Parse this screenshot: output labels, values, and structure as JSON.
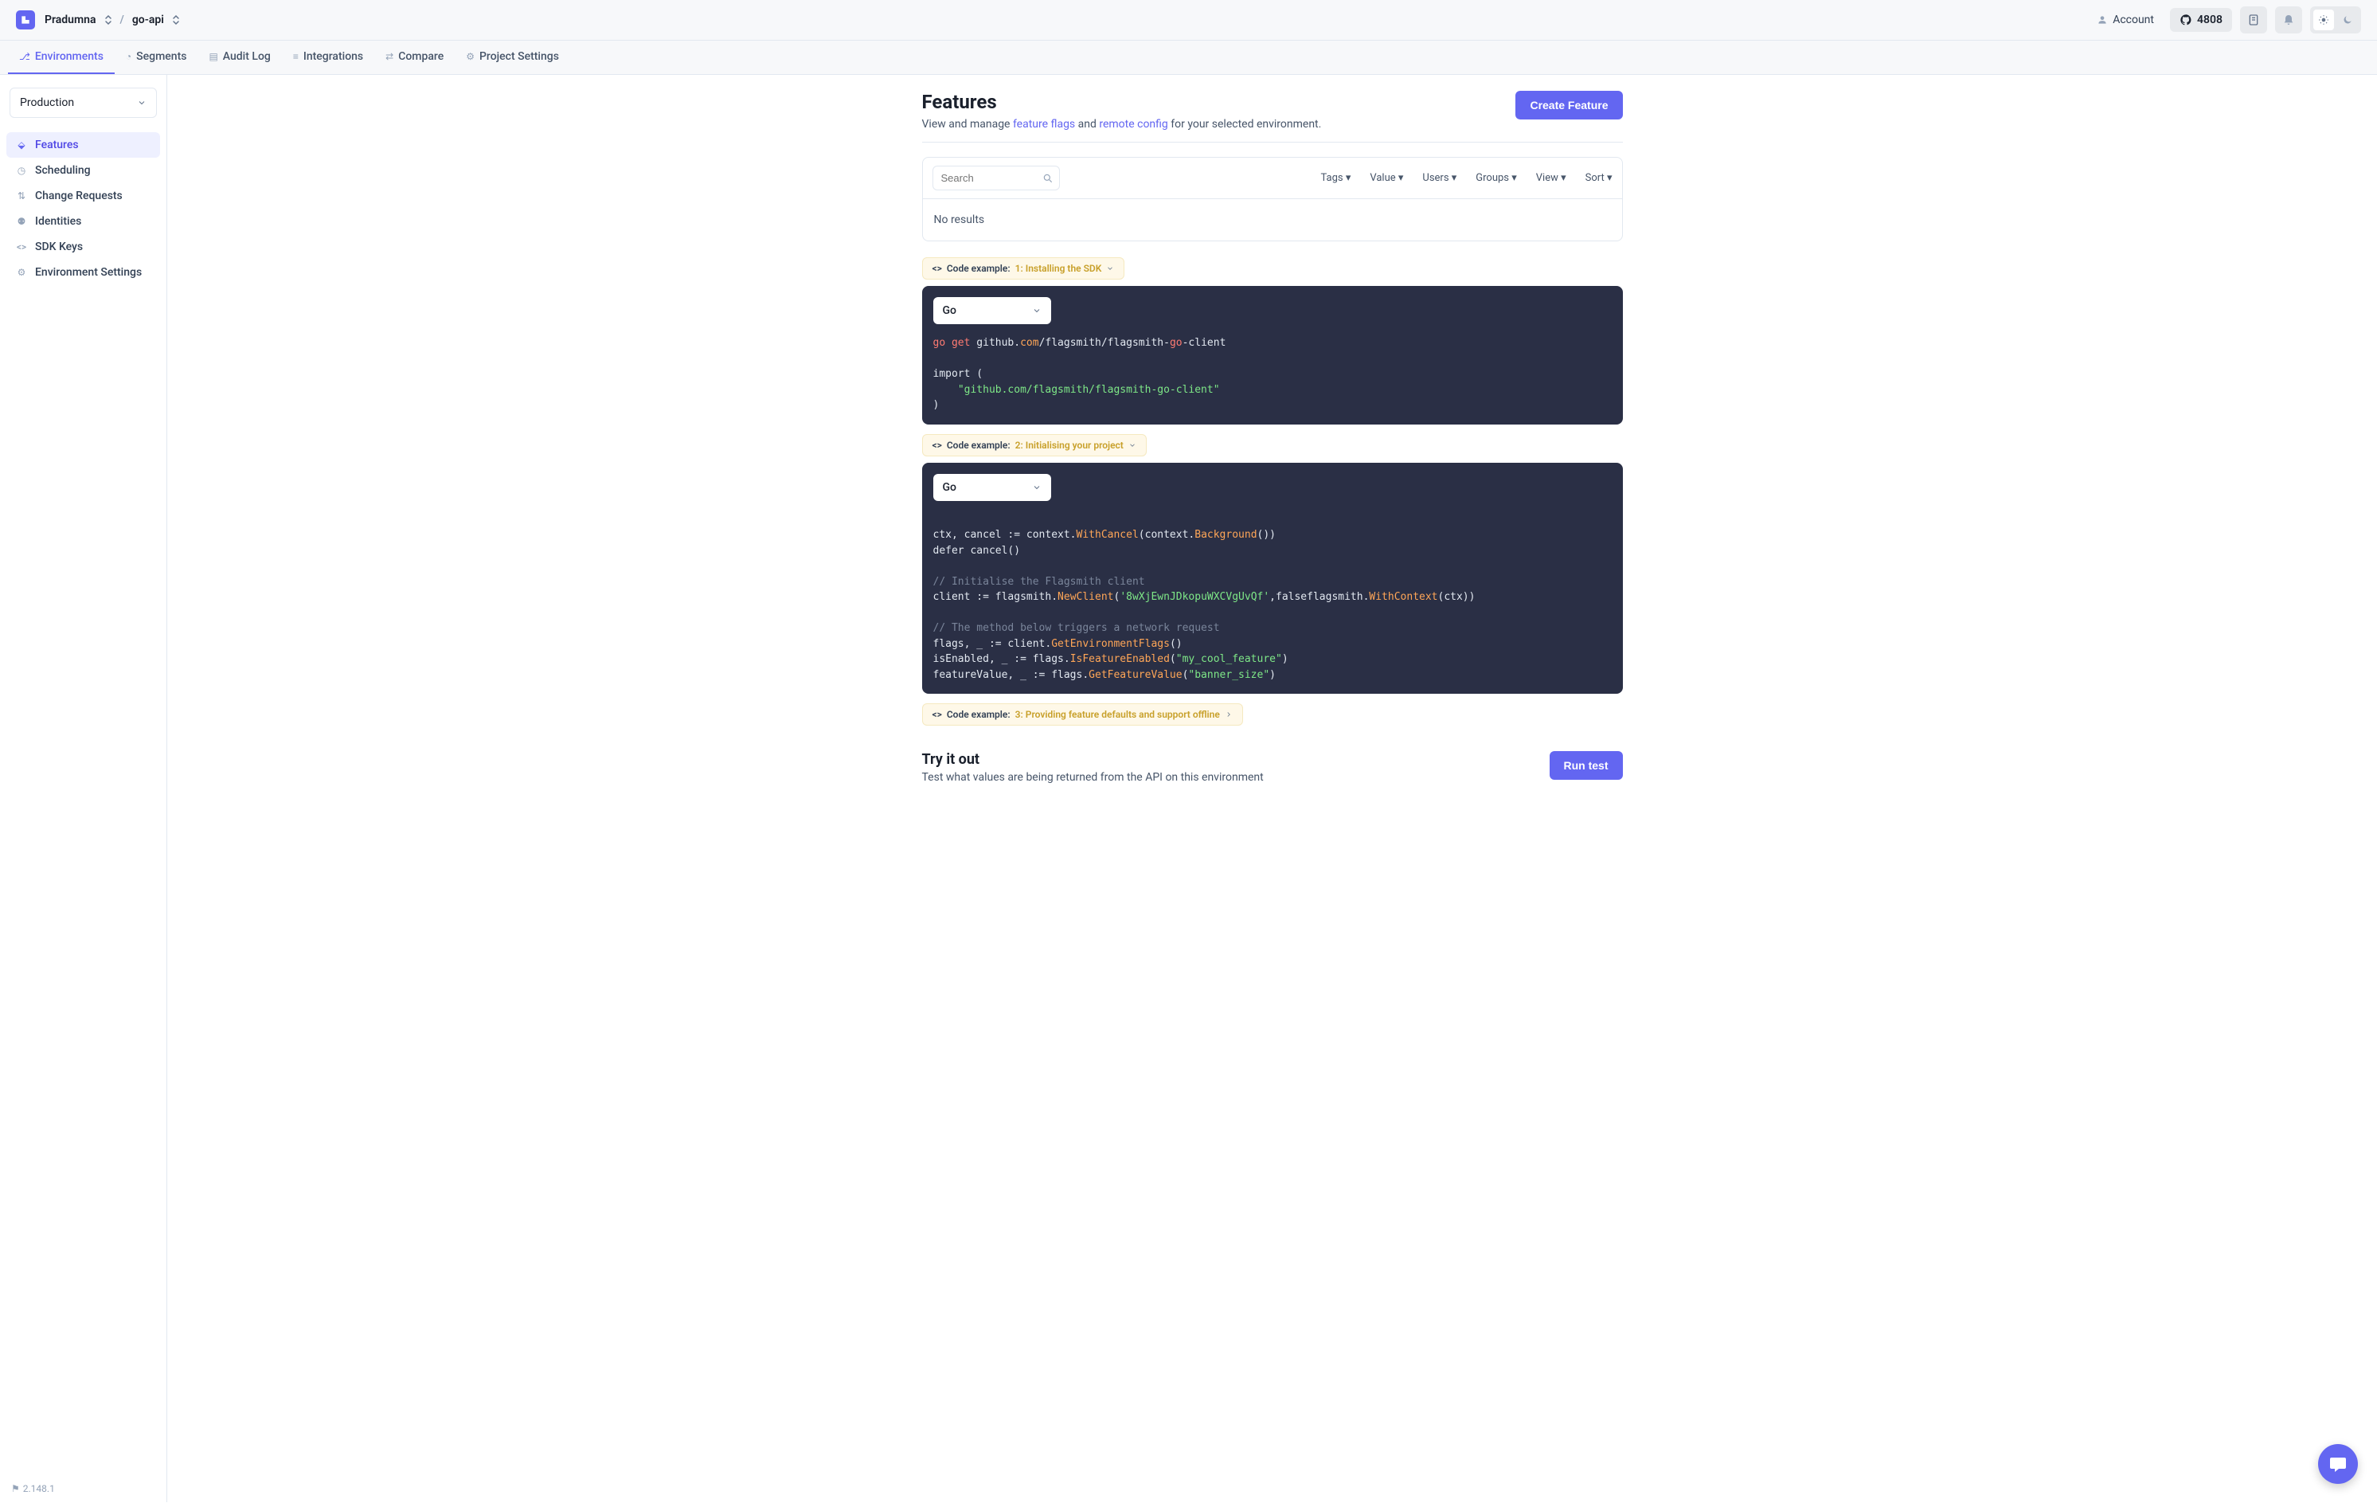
{
  "header": {
    "org": "Pradumna",
    "project": "go-api",
    "account": "Account",
    "github_stars": "4808"
  },
  "tabs": [
    {
      "id": "environments",
      "label": "Environments",
      "active": true
    },
    {
      "id": "segments",
      "label": "Segments",
      "active": false
    },
    {
      "id": "audit",
      "label": "Audit Log",
      "active": false
    },
    {
      "id": "integrations",
      "label": "Integrations",
      "active": false
    },
    {
      "id": "compare",
      "label": "Compare",
      "active": false
    },
    {
      "id": "settings",
      "label": "Project Settings",
      "active": false
    }
  ],
  "sidebar": {
    "env": "Production",
    "items": [
      {
        "id": "features",
        "label": "Features",
        "active": true
      },
      {
        "id": "scheduling",
        "label": "Scheduling",
        "active": false
      },
      {
        "id": "change-requests",
        "label": "Change Requests",
        "active": false
      },
      {
        "id": "identities",
        "label": "Identities",
        "active": false
      },
      {
        "id": "sdk-keys",
        "label": "SDK Keys",
        "active": false
      },
      {
        "id": "env-settings",
        "label": "Environment Settings",
        "active": false
      }
    ],
    "version": "2.148.1"
  },
  "page": {
    "title": "Features",
    "subtitle_pre": "View and manage ",
    "subtitle_link1": "feature flags",
    "subtitle_mid": " and ",
    "subtitle_link2": "remote config",
    "subtitle_post": " for your selected environment.",
    "create_btn": "Create Feature"
  },
  "filters": {
    "search_placeholder": "Search",
    "links": [
      "Tags",
      "Value",
      "Users",
      "Groups",
      "View",
      "Sort"
    ],
    "no_results": "No results"
  },
  "code_examples": {
    "label_prefix": "Code example:",
    "step1": "1: Installing the SDK",
    "step2": "2: Initialising your project",
    "step3": "3: Providing feature defaults and support offline",
    "lang": "Go"
  },
  "try": {
    "title": "Try it out",
    "desc": "Test what values are being returned from the API on this environment",
    "btn": "Run test"
  }
}
